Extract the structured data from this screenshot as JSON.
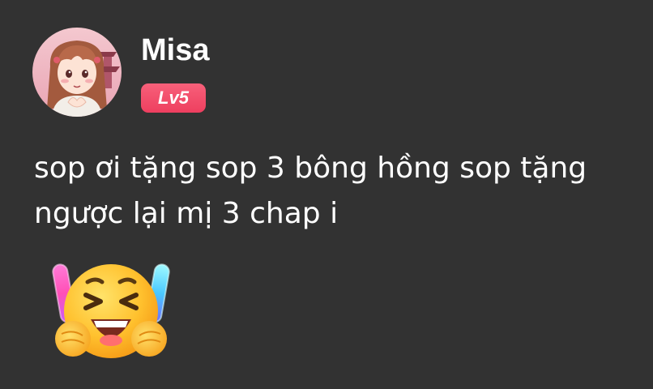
{
  "user": {
    "name": "Misa",
    "level": "Lv5",
    "avatar_icon": "anime-girl-avatar-icon"
  },
  "message": {
    "text": "sop ơi tặng sop 3 bông hồng sop tặng ngược lại mị 3 chap i"
  },
  "sticker": {
    "icon": "cheering-face-with-glowsticks-icon"
  },
  "colors": {
    "background": "#323232",
    "text": "#ffffff",
    "badge": "#f04c68"
  }
}
